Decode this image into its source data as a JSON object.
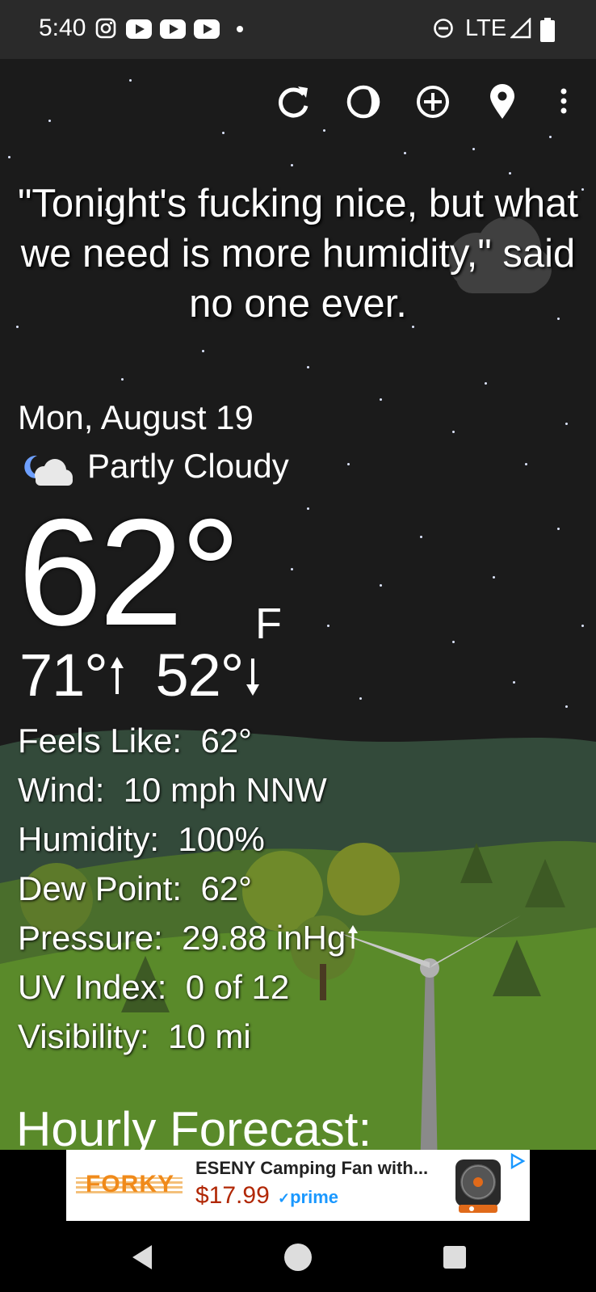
{
  "status_bar": {
    "time": "5:40",
    "network": "LTE",
    "notification_icons": [
      "instagram-icon",
      "youtube-icon",
      "youtube-icon",
      "youtube-icon"
    ]
  },
  "toolbar": {
    "icons": [
      "refresh-icon",
      "moon-phase-icon",
      "add-location-icon",
      "location-pin-icon",
      "more-menu-icon"
    ]
  },
  "quote": "\"Tonight's fucking nice, but what we need is more humidity,\" said no one ever.",
  "weather": {
    "date": "Mon, August 19",
    "condition": "Partly Cloudy",
    "condition_icon": "partly-cloudy-night-icon",
    "temperature": "62°",
    "unit": "F",
    "high": "71°",
    "low": "52°"
  },
  "details": [
    {
      "label": "Feels Like:",
      "value": "62°"
    },
    {
      "label": "Wind:",
      "value": "10 mph NNW"
    },
    {
      "label": "Humidity:",
      "value": "100%"
    },
    {
      "label": "Dew Point:",
      "value": "62°"
    },
    {
      "label": "Pressure:",
      "value": "29.88 inHg"
    },
    {
      "label": "UV Index:",
      "value": "0 of 12"
    },
    {
      "label": "Visibility:",
      "value": "10 mi"
    }
  ],
  "hourly_heading": "Hourly Forecast:",
  "ad": {
    "brand": "FORKY",
    "title": "ESENY Camping Fan with...",
    "price": "$17.99",
    "prime": "prime",
    "badge_icon": "ad-choices-icon"
  },
  "colors": {
    "sky": "#1b1b1b",
    "grass": "#5a8a2a",
    "status_bar": "#2a2a2a",
    "price": "#b12704",
    "prime": "#1a98ff"
  }
}
